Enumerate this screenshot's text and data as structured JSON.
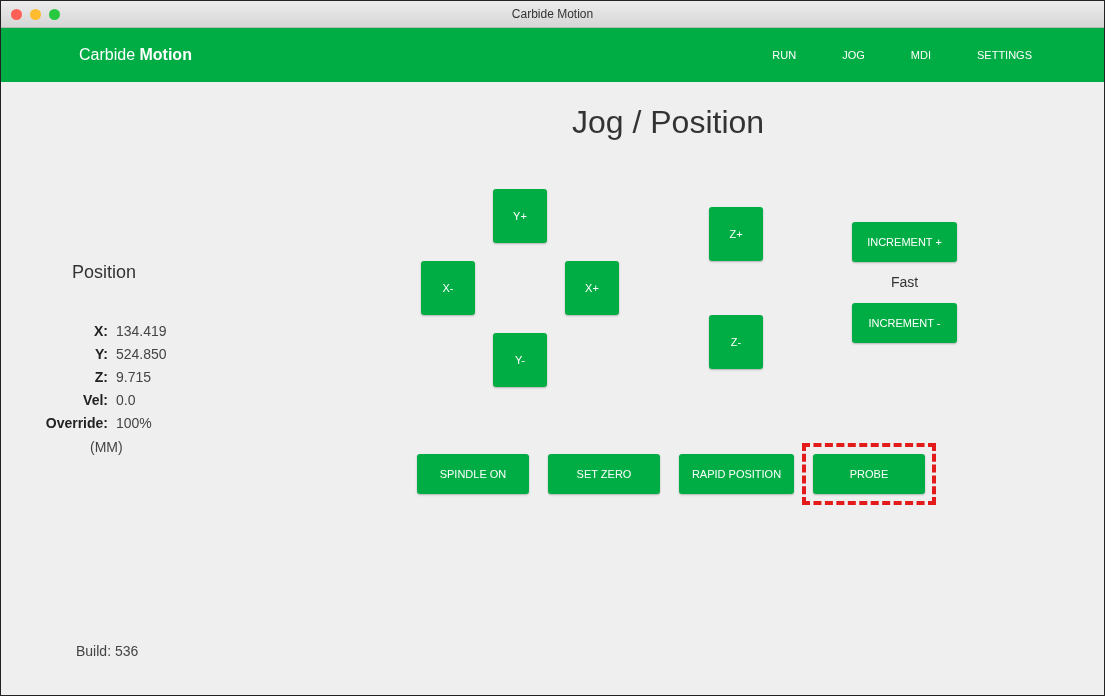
{
  "window": {
    "title": "Carbide Motion"
  },
  "header": {
    "brand": "Carbide **Motion**",
    "nav": [
      "RUN",
      "JOG",
      "MDI",
      "SETTINGS"
    ]
  },
  "position": {
    "title": "Position",
    "readings": [
      {
        "label": "X:",
        "value": "134.419"
      },
      {
        "label": "Y:",
        "value": "524.850"
      },
      {
        "label": "Z:",
        "value": "9.715"
      },
      {
        "label": "Vel:",
        "value": "0.0"
      },
      {
        "label": "Override:",
        "value": "100%"
      }
    ],
    "units": "(MM)",
    "build": "Build: 536"
  },
  "page_title": "Jog / Position",
  "xy_buttons": [
    "Y+",
    "X-",
    "X+",
    "Y-"
  ],
  "z_buttons": [
    "Z+",
    "Z-"
  ],
  "increment": {
    "up": "INCREMENT +",
    "speed": "Fast",
    "down": "INCREMENT -"
  },
  "actions": [
    {
      "label": "SPINDLE ON",
      "highlighted": false
    },
    {
      "label": "SET ZERO",
      "highlighted": false
    },
    {
      "label": "RAPID POSITION",
      "highlighted": false
    },
    {
      "label": "PROBE",
      "highlighted": true
    }
  ]
}
